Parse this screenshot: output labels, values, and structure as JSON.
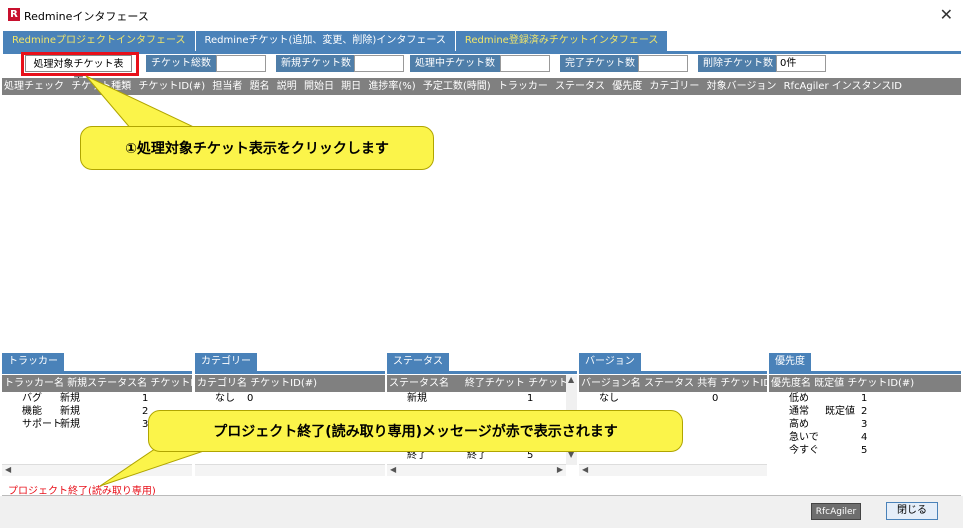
{
  "window": {
    "title": "Redmineインタフェース",
    "icon_letter": "R"
  },
  "tabs": [
    {
      "label": "Redmineプロジェクトインタフェース"
    },
    {
      "label": "Redmineチケット(追加、変更、削除)インタフェース"
    },
    {
      "label": "Redmine登録済みチケットインタフェース"
    }
  ],
  "toolbar": {
    "show_button": "処理対象チケット表示",
    "total_label": "チケット総数",
    "total_value": "",
    "new_label": "新規チケット数",
    "new_value": "",
    "inprogress_label": "処理中チケット数",
    "inprogress_value": "",
    "done_label": "完了チケット数",
    "done_value": "",
    "deleted_label": "削除チケット数",
    "deleted_value": "0件"
  },
  "grid": {
    "columns": [
      "処理チェック",
      "チケット種類",
      "チケットID(#)",
      "担当者",
      "題名",
      "説明",
      "開始日",
      "期日",
      "進捗率(%)",
      "予定工数(時間)",
      "トラッカー",
      "ステータス",
      "優先度",
      "カテゴリー",
      "対象バージョン",
      "RfcAgiler インスタンスID"
    ]
  },
  "panels": {
    "tracker": {
      "tab": "トラッカー",
      "columns": [
        "トラッカー名",
        "新規ステータス名",
        "チケットID("
      ],
      "rows": [
        [
          "バグ",
          "新規",
          "1"
        ],
        [
          "機能",
          "新規",
          "2"
        ],
        [
          "サポート",
          "新規",
          "3"
        ]
      ]
    },
    "category": {
      "tab": "カテゴリー",
      "columns": [
        "カテゴリ名",
        "チケットID(#)"
      ],
      "rows": [
        [
          "なし",
          "0"
        ]
      ]
    },
    "status": {
      "tab": "ステータス",
      "columns": [
        "ステータス名",
        "終了チケット",
        "チケット"
      ],
      "rows": [
        [
          "新規",
          "",
          "1"
        ],
        [
          "終了",
          "終了",
          "5"
        ]
      ]
    },
    "version": {
      "tab": "バージョン",
      "columns": [
        "バージョン名",
        "ステータス",
        "共有",
        "チケットID(#"
      ],
      "rows": [
        [
          "なし",
          "",
          "",
          "0"
        ]
      ]
    },
    "priority": {
      "tab": "優先度",
      "columns": [
        "優先度名",
        "既定値",
        "チケットID(#)"
      ],
      "rows": [
        [
          "低め",
          "",
          "1"
        ],
        [
          "通常",
          "既定値",
          "2"
        ],
        [
          "高め",
          "",
          "3"
        ],
        [
          "急いで",
          "",
          "4"
        ],
        [
          "今すぐ",
          "",
          "5"
        ]
      ]
    }
  },
  "status_message": "プロジェクト終了(読み取り専用)",
  "buttons": {
    "rfc": "RfcAgiler",
    "close": "閉じる"
  },
  "callouts": {
    "first": "①処理対象チケット表示をクリックします",
    "second": "プロジェクト終了(読み取り専用)メッセージが赤で表示されます"
  },
  "colors": {
    "tab_blue": "#4a82b9",
    "header_gray": "#808080",
    "highlight_red": "#e8101a",
    "callout_yellow": "#fbf44a"
  }
}
